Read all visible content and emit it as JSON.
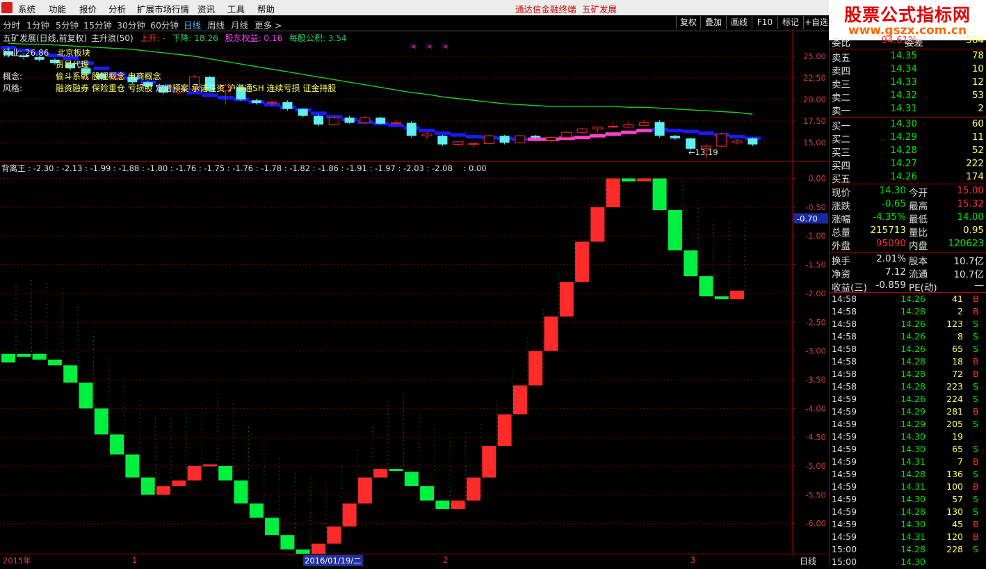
{
  "menu": {
    "items": [
      "系统",
      "功能",
      "报价",
      "分析",
      "扩展市场行情",
      "资讯",
      "工具",
      "帮助"
    ],
    "center_app": "通达信金融终端",
    "center_stock": "五矿发展"
  },
  "watermark": {
    "title": "股票公式指标网",
    "url": "www.gszx.com.cn"
  },
  "toolbar": {
    "periods": [
      "分时",
      "1分钟",
      "5分钟",
      "15分钟",
      "30分钟",
      "60分钟",
      "日线",
      "周线",
      "月线",
      "更多 >"
    ],
    "active_period": "日线",
    "right_buttons": [
      "复权",
      "叠加",
      "画线",
      "F10",
      "标记",
      "+自选"
    ]
  },
  "upper_chart": {
    "title": "五矿发展(日线,前复权)",
    "indicator": "主升浪(50)",
    "up_label": "上升: -",
    "down_label": "下降: 18.26",
    "equity_label": "股东权益: 0.16",
    "fund_label": "每股公积: 3.54",
    "high_marker": "26.86",
    "low_marker": "←13.19",
    "info": [
      {
        "label": "行业:",
        "value": "北京板块"
      },
      {
        "label": "",
        "value": "贸易代理"
      },
      {
        "label": "概念:",
        "value": "偷斗系戰 股理概念 电商概念"
      },
      {
        "label": "风格:",
        "value": "融资融券 保险重仓 亏损股 定增预案 承诺注资 沪港通SH 连续亏损 证金持股"
      }
    ],
    "y_ticks": [
      "25.00",
      "22.50",
      "20.00",
      "17.50",
      "15.00"
    ]
  },
  "oscillator": {
    "name": "背离王",
    "legend_values": [
      "-2.30",
      "-2.13",
      "-1.99",
      "-1.88",
      "-1.80",
      "-1.76",
      "-1.75",
      "-1.76",
      "-1.78",
      "-1.82",
      "-1.86",
      "-1.91",
      "-1.97",
      "-2.03",
      "-2.08"
    ],
    "legend_tail": ": 0.00",
    "cursor_value": "-0.70",
    "y_ticks": [
      "0.00",
      "-0.50",
      "-1.00",
      "-1.50",
      "-2.00",
      "-2.50",
      "-3.00",
      "-3.50",
      "-4.00",
      "-4.50",
      "-5.00",
      "-5.50",
      "-6.00"
    ]
  },
  "chart_data": [
    {
      "type": "candlestick",
      "title": "五矿发展(日线,前复权)",
      "ylim": [
        13,
        27
      ],
      "candles": [
        [
          25.6,
          25.1,
          26.0,
          24.9
        ],
        [
          25.1,
          24.9,
          25.4,
          24.6
        ],
        [
          24.9,
          24.6,
          25.0,
          24.4
        ],
        [
          24.6,
          24.2,
          24.8,
          24.0
        ],
        [
          24.2,
          23.6,
          24.4,
          23.4
        ],
        [
          23.6,
          23.0,
          23.8,
          22.8
        ],
        [
          23.0,
          22.4,
          23.2,
          22.2
        ],
        [
          22.4,
          22.7,
          23.0,
          22.2
        ],
        [
          22.6,
          22.0,
          22.8,
          21.8
        ],
        [
          22.0,
          21.5,
          22.2,
          21.3
        ],
        [
          21.5,
          20.8,
          21.7,
          20.6
        ],
        [
          20.8,
          21.2,
          21.4,
          20.6
        ],
        [
          21.2,
          22.6,
          22.8,
          21.0
        ],
        [
          22.6,
          21.0,
          22.7,
          20.8
        ],
        [
          21.0,
          21.6,
          21.8,
          19.4
        ],
        [
          21.4,
          20.0,
          21.5,
          19.8
        ],
        [
          19.9,
          19.6,
          20.1,
          19.4
        ],
        [
          19.6,
          19.7,
          19.9,
          19.3
        ],
        [
          19.7,
          18.9,
          19.9,
          18.7
        ],
        [
          18.9,
          18.1,
          19.0,
          17.9
        ],
        [
          18.1,
          17.1,
          18.3,
          16.9
        ],
        [
          17.1,
          17.9,
          18.1,
          16.9
        ],
        [
          17.9,
          17.3,
          18.1,
          17.2
        ],
        [
          17.3,
          17.9,
          18.1,
          17.1
        ],
        [
          17.9,
          17.2,
          18.0,
          17.1
        ],
        [
          17.2,
          17.3,
          17.6,
          17.1
        ],
        [
          17.3,
          15.8,
          17.5,
          15.6
        ],
        [
          15.8,
          16.0,
          16.2,
          15.4
        ],
        [
          15.8,
          14.8,
          15.9,
          14.6
        ],
        [
          14.8,
          15.1,
          15.2,
          14.6
        ],
        [
          14.8,
          14.9,
          15.1,
          14.5
        ],
        [
          14.9,
          15.8,
          15.9,
          14.8
        ],
        [
          15.8,
          15.0,
          15.9,
          14.8
        ],
        [
          15.0,
          15.8,
          15.9,
          14.9
        ],
        [
          15.8,
          15.6,
          15.9,
          15.4
        ],
        [
          15.3,
          15.6,
          15.8,
          15.0
        ],
        [
          15.6,
          16.2,
          16.3,
          15.5
        ],
        [
          16.2,
          16.6,
          16.7,
          16.0
        ],
        [
          16.6,
          16.8,
          16.9,
          16.2
        ],
        [
          16.8,
          16.9,
          17.3,
          16.7
        ],
        [
          16.8,
          17.1,
          17.4,
          16.7
        ],
        [
          17.0,
          17.3,
          17.6,
          16.9
        ],
        [
          17.4,
          15.8,
          17.6,
          15.6
        ],
        [
          15.8,
          15.5,
          15.9,
          15.3
        ],
        [
          15.5,
          14.3,
          15.6,
          14.1
        ],
        [
          14.3,
          14.6,
          14.8,
          13.2
        ],
        [
          14.6,
          16.0,
          16.2,
          14.4
        ],
        [
          15.0,
          15.2,
          15.4,
          14.8
        ],
        [
          15.5,
          14.8,
          15.6,
          14.6
        ]
      ],
      "support_line": [
        26.0,
        25.7,
        25.4,
        25.1,
        24.8,
        24.2,
        23.6,
        23.0,
        22.5,
        22.0,
        21.5,
        21.1,
        20.8,
        20.5,
        20.2,
        20.0,
        19.7,
        19.4,
        19.1,
        18.8,
        18.4,
        18.0,
        17.7,
        17.4,
        17.2,
        17.0,
        16.7,
        16.4,
        16.1,
        15.9,
        15.7,
        15.6,
        15.5,
        15.4,
        15.4,
        15.4,
        15.5,
        15.6,
        15.8,
        16.0,
        16.2,
        16.4,
        16.5,
        16.4,
        16.3,
        16.1,
        15.9,
        15.7,
        15.5
      ],
      "ma_line": [
        26.5,
        26.4,
        26.4,
        26.3,
        26.2,
        26.1,
        26.0,
        25.9,
        25.8,
        25.6,
        25.4,
        25.2,
        25.0,
        24.7,
        24.4,
        24.1,
        23.8,
        23.5,
        23.2,
        22.9,
        22.6,
        22.3,
        22.0,
        21.7,
        21.4,
        21.1,
        20.8,
        20.6,
        20.3,
        20.1,
        19.9,
        19.7,
        19.5,
        19.4,
        19.3,
        19.2,
        19.2,
        19.2,
        19.2,
        19.2,
        19.1,
        19.1,
        19.0,
        18.9,
        18.8,
        18.7,
        18.6,
        18.5,
        18.3
      ]
    },
    {
      "type": "bar",
      "title": "背离王",
      "ylim": [
        -6.5,
        0.2
      ],
      "bars": [
        [
          -3.05,
          -3.2
        ],
        [
          -3.05,
          -3.1
        ],
        [
          -3.05,
          -3.15
        ],
        [
          -3.15,
          -3.25
        ],
        [
          -3.25,
          -3.55
        ],
        [
          -3.55,
          -4.0
        ],
        [
          -4.0,
          -4.45
        ],
        [
          -4.45,
          -4.8
        ],
        [
          -4.8,
          -5.2
        ],
        [
          -5.2,
          -5.5
        ],
        [
          -5.5,
          -5.35
        ],
        [
          -5.35,
          -5.25
        ],
        [
          -5.25,
          -5.0
        ],
        [
          -5.0,
          -4.97
        ],
        [
          -5.0,
          -5.25
        ],
        [
          -5.25,
          -5.65
        ],
        [
          -5.65,
          -5.9
        ],
        [
          -5.9,
          -6.2
        ],
        [
          -6.2,
          -6.45
        ],
        [
          -6.45,
          -6.55
        ],
        [
          -6.6,
          -6.35
        ],
        [
          -6.35,
          -6.05
        ],
        [
          -6.05,
          -5.65
        ],
        [
          -5.65,
          -5.2
        ],
        [
          -5.2,
          -5.05
        ],
        [
          -5.05,
          -5.08
        ],
        [
          -5.1,
          -5.35
        ],
        [
          -5.35,
          -5.6
        ],
        [
          -5.6,
          -5.75
        ],
        [
          -5.75,
          -5.6
        ],
        [
          -5.6,
          -5.2
        ],
        [
          -5.2,
          -4.65
        ],
        [
          -4.65,
          -4.1
        ],
        [
          -4.1,
          -3.6
        ],
        [
          -3.6,
          -3.0
        ],
        [
          -3.0,
          -2.4
        ],
        [
          -2.4,
          -1.8
        ],
        [
          -1.8,
          -1.1
        ],
        [
          -1.1,
          -0.5
        ],
        [
          -0.5,
          0.0
        ],
        [
          0.0,
          -0.05
        ],
        [
          -0.05,
          0.0
        ],
        [
          0.0,
          -0.55
        ],
        [
          -0.55,
          -1.25
        ],
        [
          -1.25,
          -1.7
        ],
        [
          -1.7,
          -2.05
        ],
        [
          -2.05,
          -2.1
        ],
        [
          -2.1,
          -1.95
        ]
      ],
      "series": [
        {
          "values": [
            -3.2,
            -3.1,
            -3.15,
            -3.25,
            -3.55,
            -4.0,
            -4.45,
            -4.8,
            -5.2,
            -5.5,
            -5.35,
            -5.25,
            -5.0,
            -4.97,
            -5.25,
            -5.65,
            -5.9,
            -6.2,
            -6.45,
            -6.55,
            -6.35,
            -6.05,
            -5.65,
            -5.2,
            -5.05,
            -5.08,
            -5.35,
            -5.6,
            -5.75,
            -5.6,
            -5.2,
            -4.65,
            -4.1,
            -3.6,
            -3.0,
            -2.4,
            -1.8,
            -1.1,
            -0.5,
            0.0,
            -0.05,
            0.0,
            -0.55,
            -1.25,
            -1.7,
            -2.05,
            -2.1,
            -1.95
          ]
        }
      ]
    }
  ],
  "time_axis": {
    "labels": [
      "2015年",
      "1",
      "2016/01/19/二",
      "2",
      "3"
    ],
    "period": "日线"
  },
  "quote": {
    "top_partial": {
      "label": "委比",
      "value": "94.61%",
      "label2": "委差",
      "value2": "564"
    },
    "asks": [
      {
        "label": "卖五",
        "price": "14.35",
        "vol": "78"
      },
      {
        "label": "卖四",
        "price": "14.34",
        "vol": "10"
      },
      {
        "label": "卖三",
        "price": "14.33",
        "vol": "12"
      },
      {
        "label": "卖二",
        "price": "14.32",
        "vol": "53"
      },
      {
        "label": "卖一",
        "price": "14.31",
        "vol": "2"
      }
    ],
    "bids": [
      {
        "label": "买一",
        "price": "14.30",
        "vol": "60"
      },
      {
        "label": "买二",
        "price": "14.29",
        "vol": "11"
      },
      {
        "label": "买三",
        "price": "14.28",
        "vol": "52"
      },
      {
        "label": "买四",
        "price": "14.27",
        "vol": "222"
      },
      {
        "label": "买五",
        "price": "14.26",
        "vol": "174"
      }
    ],
    "stats": [
      {
        "k1": "现价",
        "v1": "14.30",
        "c1": "green",
        "k2": "今开",
        "v2": "15.00",
        "c2": "red"
      },
      {
        "k1": "涨跌",
        "v1": "-0.65",
        "c1": "green",
        "k2": "最高",
        "v2": "15.32",
        "c2": "red"
      },
      {
        "k1": "涨幅",
        "v1": "-4.35%",
        "c1": "green",
        "k2": "最低",
        "v2": "14.00",
        "c2": "green"
      },
      {
        "k1": "总量",
        "v1": "215713",
        "c1": "yellow",
        "k2": "量比",
        "v2": "0.95",
        "c2": "yellow"
      },
      {
        "k1": "外盘",
        "v1": "95090",
        "c1": "red",
        "k2": "内盘",
        "v2": "120623",
        "c2": "green"
      }
    ],
    "finance": [
      {
        "k1": "换手",
        "v1": "2.01%",
        "k2": "股本",
        "v2": "10.7亿"
      },
      {
        "k1": "净资",
        "v1": "7.12",
        "k2": "流通",
        "v2": "10.7亿"
      },
      {
        "k1": "收益(三)",
        "v1": "-0.859",
        "k2": "PE(动)",
        "v2": "—"
      }
    ],
    "ticks": [
      {
        "t": "14:58",
        "p": "14.26",
        "v": "41",
        "s": "B"
      },
      {
        "t": "14:58",
        "p": "14.28",
        "v": "2",
        "s": "B"
      },
      {
        "t": "14:58",
        "p": "14.26",
        "v": "123",
        "s": "S"
      },
      {
        "t": "14:58",
        "p": "14.26",
        "v": "8",
        "s": "S"
      },
      {
        "t": "14:58",
        "p": "14.26",
        "v": "65",
        "s": "S"
      },
      {
        "t": "14:58",
        "p": "14.28",
        "v": "18",
        "s": "B"
      },
      {
        "t": "14:58",
        "p": "14.28",
        "v": "72",
        "s": "B"
      },
      {
        "t": "14:58",
        "p": "14.28",
        "v": "223",
        "s": "S"
      },
      {
        "t": "14:59",
        "p": "14.26",
        "v": "224",
        "s": "S"
      },
      {
        "t": "14:59",
        "p": "14.29",
        "v": "281",
        "s": "B"
      },
      {
        "t": "14:59",
        "p": "14.29",
        "v": "205",
        "s": "S"
      },
      {
        "t": "14:59",
        "p": "14.30",
        "v": "19",
        "s": ""
      },
      {
        "t": "14:59",
        "p": "14.30",
        "v": "65",
        "s": "S"
      },
      {
        "t": "14:59",
        "p": "14.31",
        "v": "7",
        "s": "B"
      },
      {
        "t": "14:59",
        "p": "14.28",
        "v": "136",
        "s": "S"
      },
      {
        "t": "14:59",
        "p": "14.31",
        "v": "100",
        "s": "B"
      },
      {
        "t": "14:59",
        "p": "14.30",
        "v": "57",
        "s": "S"
      },
      {
        "t": "14:59",
        "p": "14.28",
        "v": "130",
        "s": "S"
      },
      {
        "t": "14:59",
        "p": "14.30",
        "v": "45",
        "s": "B"
      },
      {
        "t": "14:59",
        "p": "14.31",
        "v": "120",
        "s": "B"
      },
      {
        "t": "15:00",
        "p": "14.28",
        "v": "228",
        "s": "S"
      },
      {
        "t": "15:00",
        "p": "14.30",
        "v": "",
        "s": ""
      }
    ]
  },
  "colors": {
    "up": "#ff2a2a",
    "down": "#00f040",
    "candle_down": "#5ff0f0",
    "support": "#1a1aff",
    "support_up": "#ff40c8",
    "ma": "#20d020",
    "grid": "#7a0000",
    "axis": "#b00000"
  }
}
